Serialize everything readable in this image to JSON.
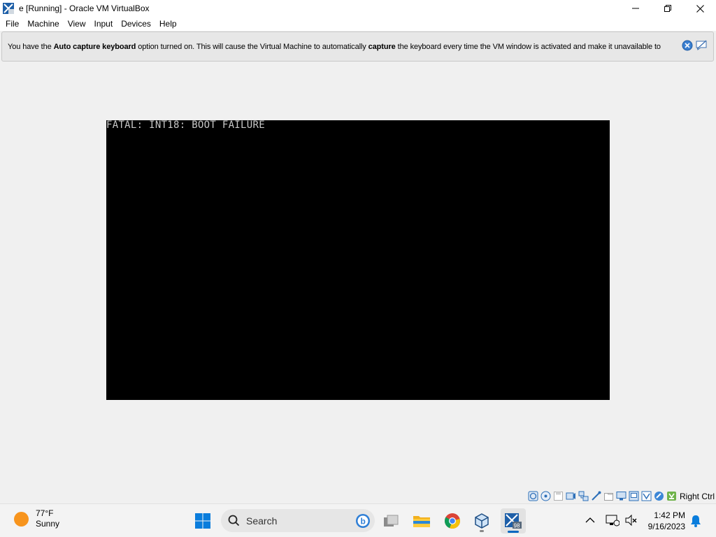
{
  "window": {
    "title": "e [Running] - Oracle VM VirtualBox",
    "minimize_icon": "minimize-icon",
    "maximize_icon": "restore-icon",
    "close_icon": "close-icon"
  },
  "menu": {
    "items": [
      "File",
      "Machine",
      "View",
      "Input",
      "Devices",
      "Help"
    ]
  },
  "notice": {
    "part1": "You have the ",
    "bold1": "Auto capture keyboard",
    "part2": " option turned on. This will cause the Virtual Machine to automatically ",
    "bold2": "capture",
    "part3": " the keyboard every time the VM window is activated and make it unavailable to",
    "close_icon": "close-icon",
    "mute_icon": "mute-notice-icon"
  },
  "vm_screen": {
    "text": "FATAL: INT18: BOOT FAILURE"
  },
  "status_bar": {
    "icons": [
      "hard-disk-icon",
      "optical-drive-icon",
      "floppy-icon",
      "audio-icon",
      "network-icon",
      "usb-icon",
      "shared-folders-icon",
      "display-icon",
      "video-capture-icon",
      "cpu-icon",
      "mouse-integration-icon",
      "keyboard-icon"
    ],
    "host_key": "Right Ctrl"
  },
  "taskbar": {
    "weather_temp": "77°F",
    "weather_cond": "Sunny",
    "search_label": "Search",
    "time": "1:42 PM",
    "date": "9/16/2023"
  },
  "colors": {
    "accent": "#0067c0",
    "vm_background": "#000000",
    "vm_text": "#c8c8c8"
  }
}
